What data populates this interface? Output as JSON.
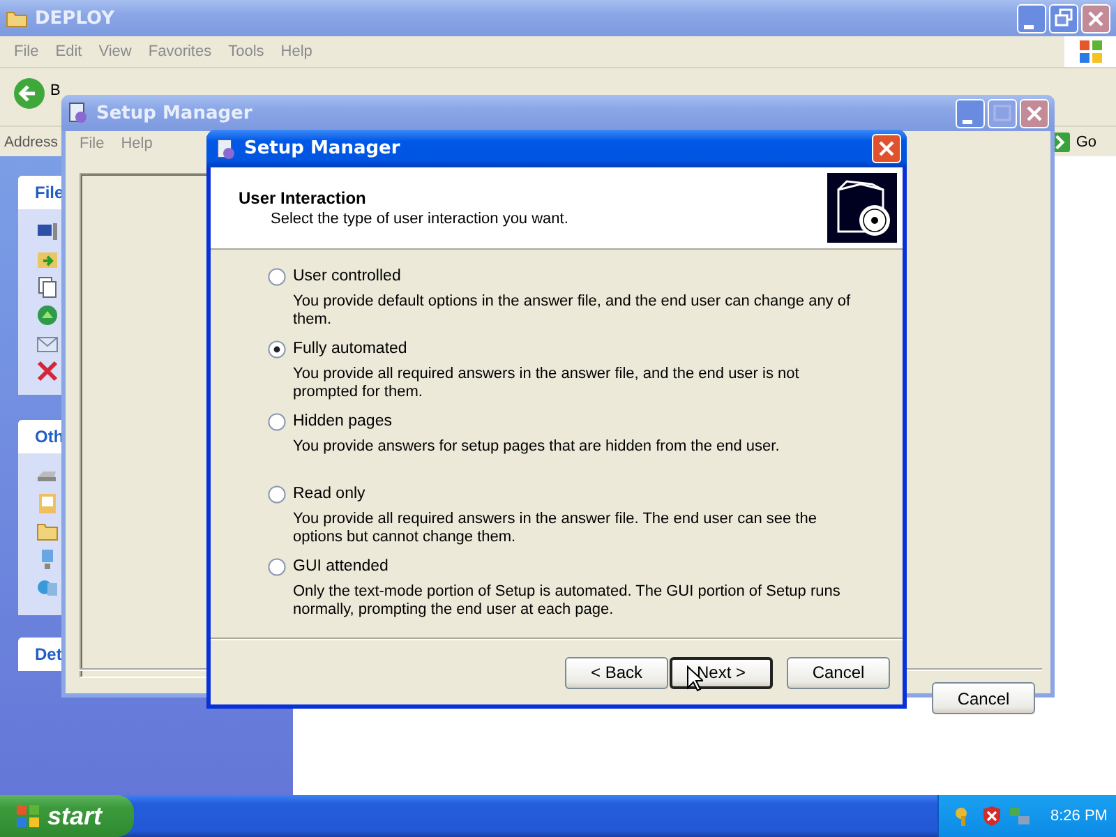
{
  "explorer": {
    "title": "DEPLOY",
    "menu": [
      "File",
      "Edit",
      "View",
      "Favorites",
      "Tools",
      "Help"
    ],
    "back_label": "B",
    "address_label": "Address",
    "go_label": "Go",
    "task_panels": [
      {
        "title": "File"
      },
      {
        "title": "Oth"
      },
      {
        "title": "Det"
      }
    ]
  },
  "setup_window": {
    "title": "Setup Manager",
    "menu": [
      "File",
      "Help"
    ],
    "cancel_label": "Cancel"
  },
  "dialog": {
    "title": "Setup Manager",
    "heading": "User Interaction",
    "subheading": "Select the type of user interaction you want.",
    "options": [
      {
        "label": "User controlled",
        "description": "You provide default options in the answer file, and the end user can change any of them.",
        "selected": false
      },
      {
        "label": "Fully automated",
        "description": "You provide all required answers in the answer file, and the end user is not prompted for them.",
        "selected": true
      },
      {
        "label": "Hidden pages",
        "description": "You provide answers for setup pages that are hidden from  the end user.",
        "selected": false
      },
      {
        "label": "Read only",
        "description": "You provide all required answers in the answer file. The end user can see the options but cannot change them.",
        "selected": false
      },
      {
        "label": "GUI attended",
        "description": "Only the text-mode portion of Setup is automated. The GUI portion of Setup runs normally, prompting the end user at each page.",
        "selected": false
      }
    ],
    "buttons": [
      {
        "label": "< Back",
        "default": false
      },
      {
        "label": "Next >",
        "default": true
      },
      {
        "label": "Cancel",
        "default": false
      }
    ]
  },
  "taskbar": {
    "start_label": "start",
    "clock": "8:26 PM"
  }
}
